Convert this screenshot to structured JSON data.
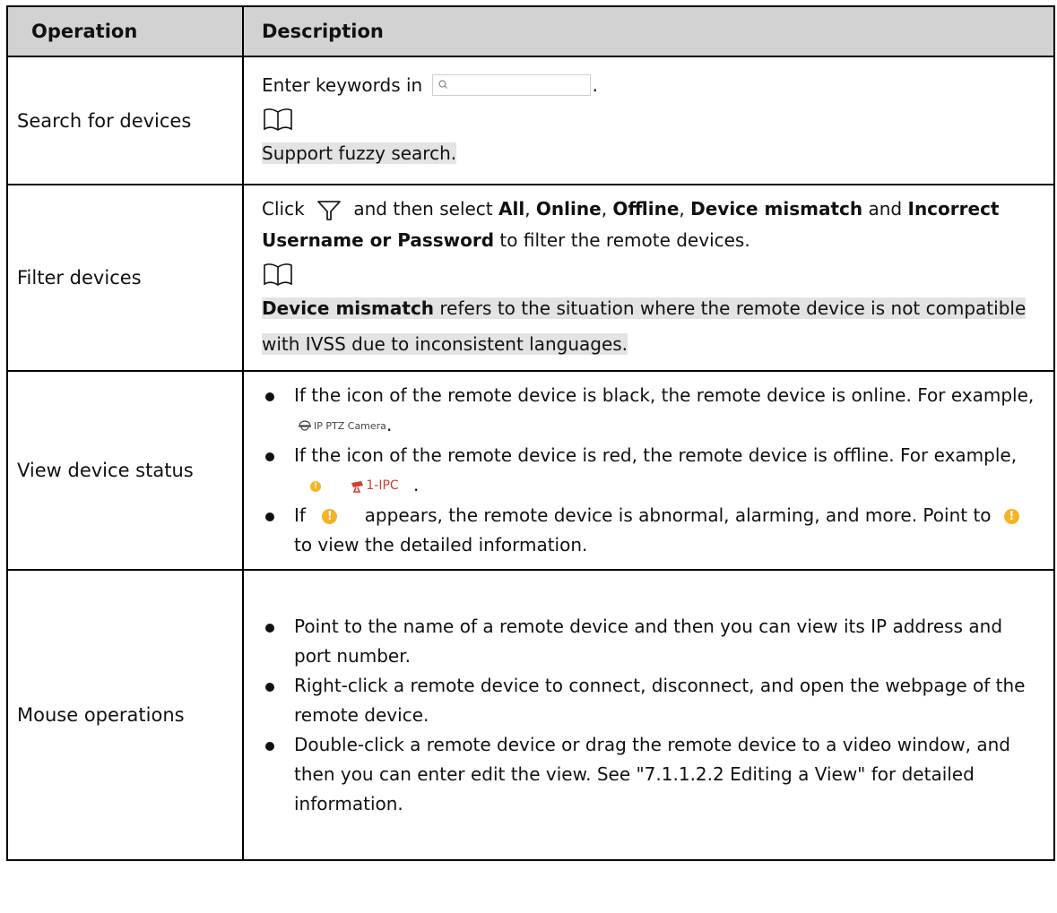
{
  "header": {
    "operation": "Operation",
    "description": "Description"
  },
  "rows": [
    {
      "operation": "Search for devices",
      "line1_pre": "Enter keywords in",
      "line1_post": ".",
      "note": "Support fuzzy search."
    },
    {
      "operation": "Filter devices",
      "p1": "Click",
      "p2": "and then select",
      "o1": "All",
      "c1": ",",
      "o2": "Online",
      "c2": ",",
      "o3": "Offline",
      "c3": ",",
      "o4": "Device mismatch",
      "and": "and",
      "o5": "Incorrect Username or Password",
      "tail": "to filter the remote devices.",
      "note_bold": "Device mismatch",
      "note_rest": "refers to the situation where the remote device is not compatible with IVSS due to inconsistent languages."
    },
    {
      "operation": "View device status",
      "b1": "If the icon of the remote device is black, the remote device is online. For example,",
      "b1_example": "IP PTZ Camera",
      "b1_end": ".",
      "b2": "If the icon of the remote device is red, the remote device is offline. For example,",
      "b2_example": "1-IPC",
      "b2_end": ".",
      "b3_pre": "If",
      "b3_mid": "appears, the remote device is abnormal, alarming, and more. Point to",
      "b3_post": "to view the detailed information."
    },
    {
      "operation": "Mouse operations",
      "b1": "Point to the name of a remote device and then you can view its IP address and port number.",
      "b2": "Right-click a remote device to connect, disconnect, and open the webpage of the remote device.",
      "b3": "Double-click a remote device or drag the remote device to a video window, and then you can enter edit the view. See \"7.1.1.2.2 Editing a View\" for detailed information."
    }
  ],
  "icons": {
    "search": "search-icon",
    "book": "book-note-icon",
    "filter": "filter-funnel-icon",
    "ptz": "ptz-camera-icon",
    "ipc": "ipc-camera-icon",
    "warning": "warning-icon"
  },
  "colors": {
    "header_bg": "#d2d2d2",
    "note_bg": "#e3e3e3",
    "warning": "#f6b324",
    "offline_red": "#d43b2f"
  }
}
